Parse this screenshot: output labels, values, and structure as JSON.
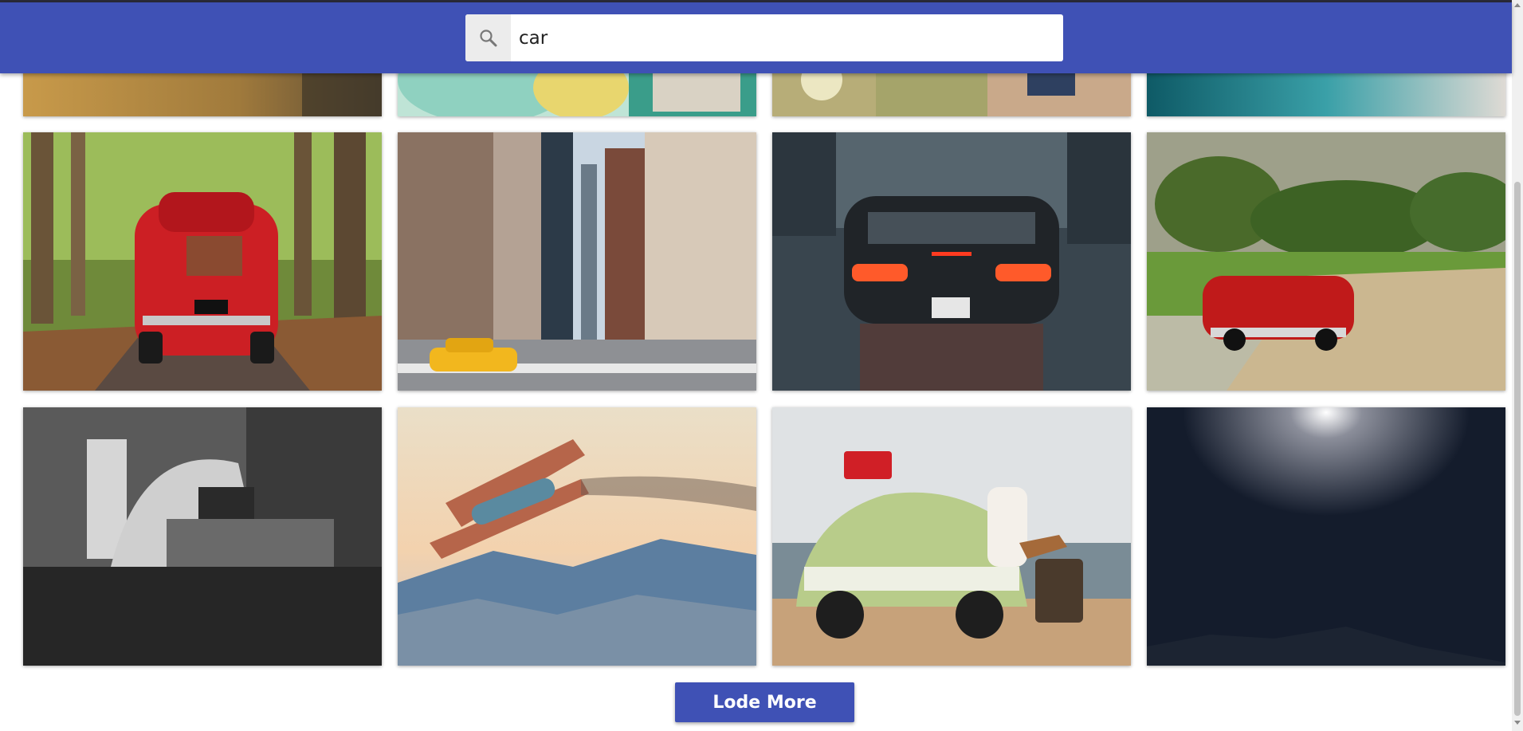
{
  "search": {
    "value": "car",
    "icon": "search-icon"
  },
  "gallery": {
    "rows": [
      [
        "forest-road-photo",
        "street-crowd-photo",
        "beetle-woman-photo",
        "teal-car-photo"
      ],
      [
        "red-fiat-forest-photo",
        "nyc-taxi-street-photo",
        "porsche-rain-photo",
        "red-vintage-convertible-photo"
      ],
      [
        "bw-garage-beetle-photo",
        "biplane-mountains-photo",
        "green-beetle-beach-photo",
        "night-moon-sky-photo"
      ]
    ]
  },
  "load_more": {
    "label": "Lode More"
  },
  "colors": {
    "header": "#3f51b5",
    "button": "#3f51b5",
    "background": "#ffffff"
  }
}
